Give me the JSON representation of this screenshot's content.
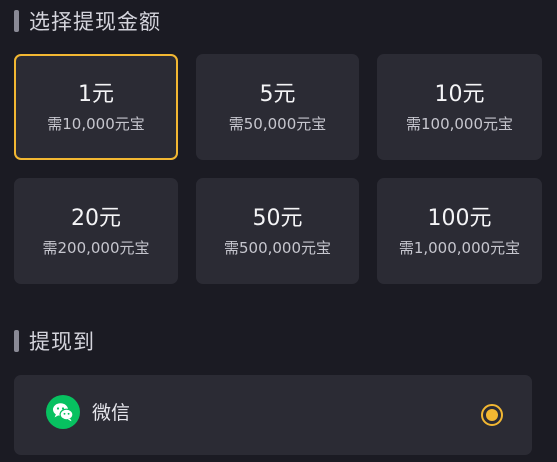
{
  "amount_section": {
    "title": "选择提现金额"
  },
  "options": [
    {
      "amount": "1元",
      "cost": "需10,000元宝",
      "selected": true
    },
    {
      "amount": "5元",
      "cost": "需50,000元宝",
      "selected": false
    },
    {
      "amount": "10元",
      "cost": "需100,000元宝",
      "selected": false
    },
    {
      "amount": "20元",
      "cost": "需200,000元宝",
      "selected": false
    },
    {
      "amount": "50元",
      "cost": "需500,000元宝",
      "selected": false
    },
    {
      "amount": "100元",
      "cost": "需1,000,000元宝",
      "selected": false
    }
  ],
  "method_section": {
    "title": "提现到"
  },
  "method": {
    "label": "微信",
    "icon": "wechat-icon",
    "selected": true
  },
  "colors": {
    "accent": "#f2b732",
    "wechat": "#07c160",
    "card": "#2b2b34",
    "background": "#1b1b23"
  }
}
